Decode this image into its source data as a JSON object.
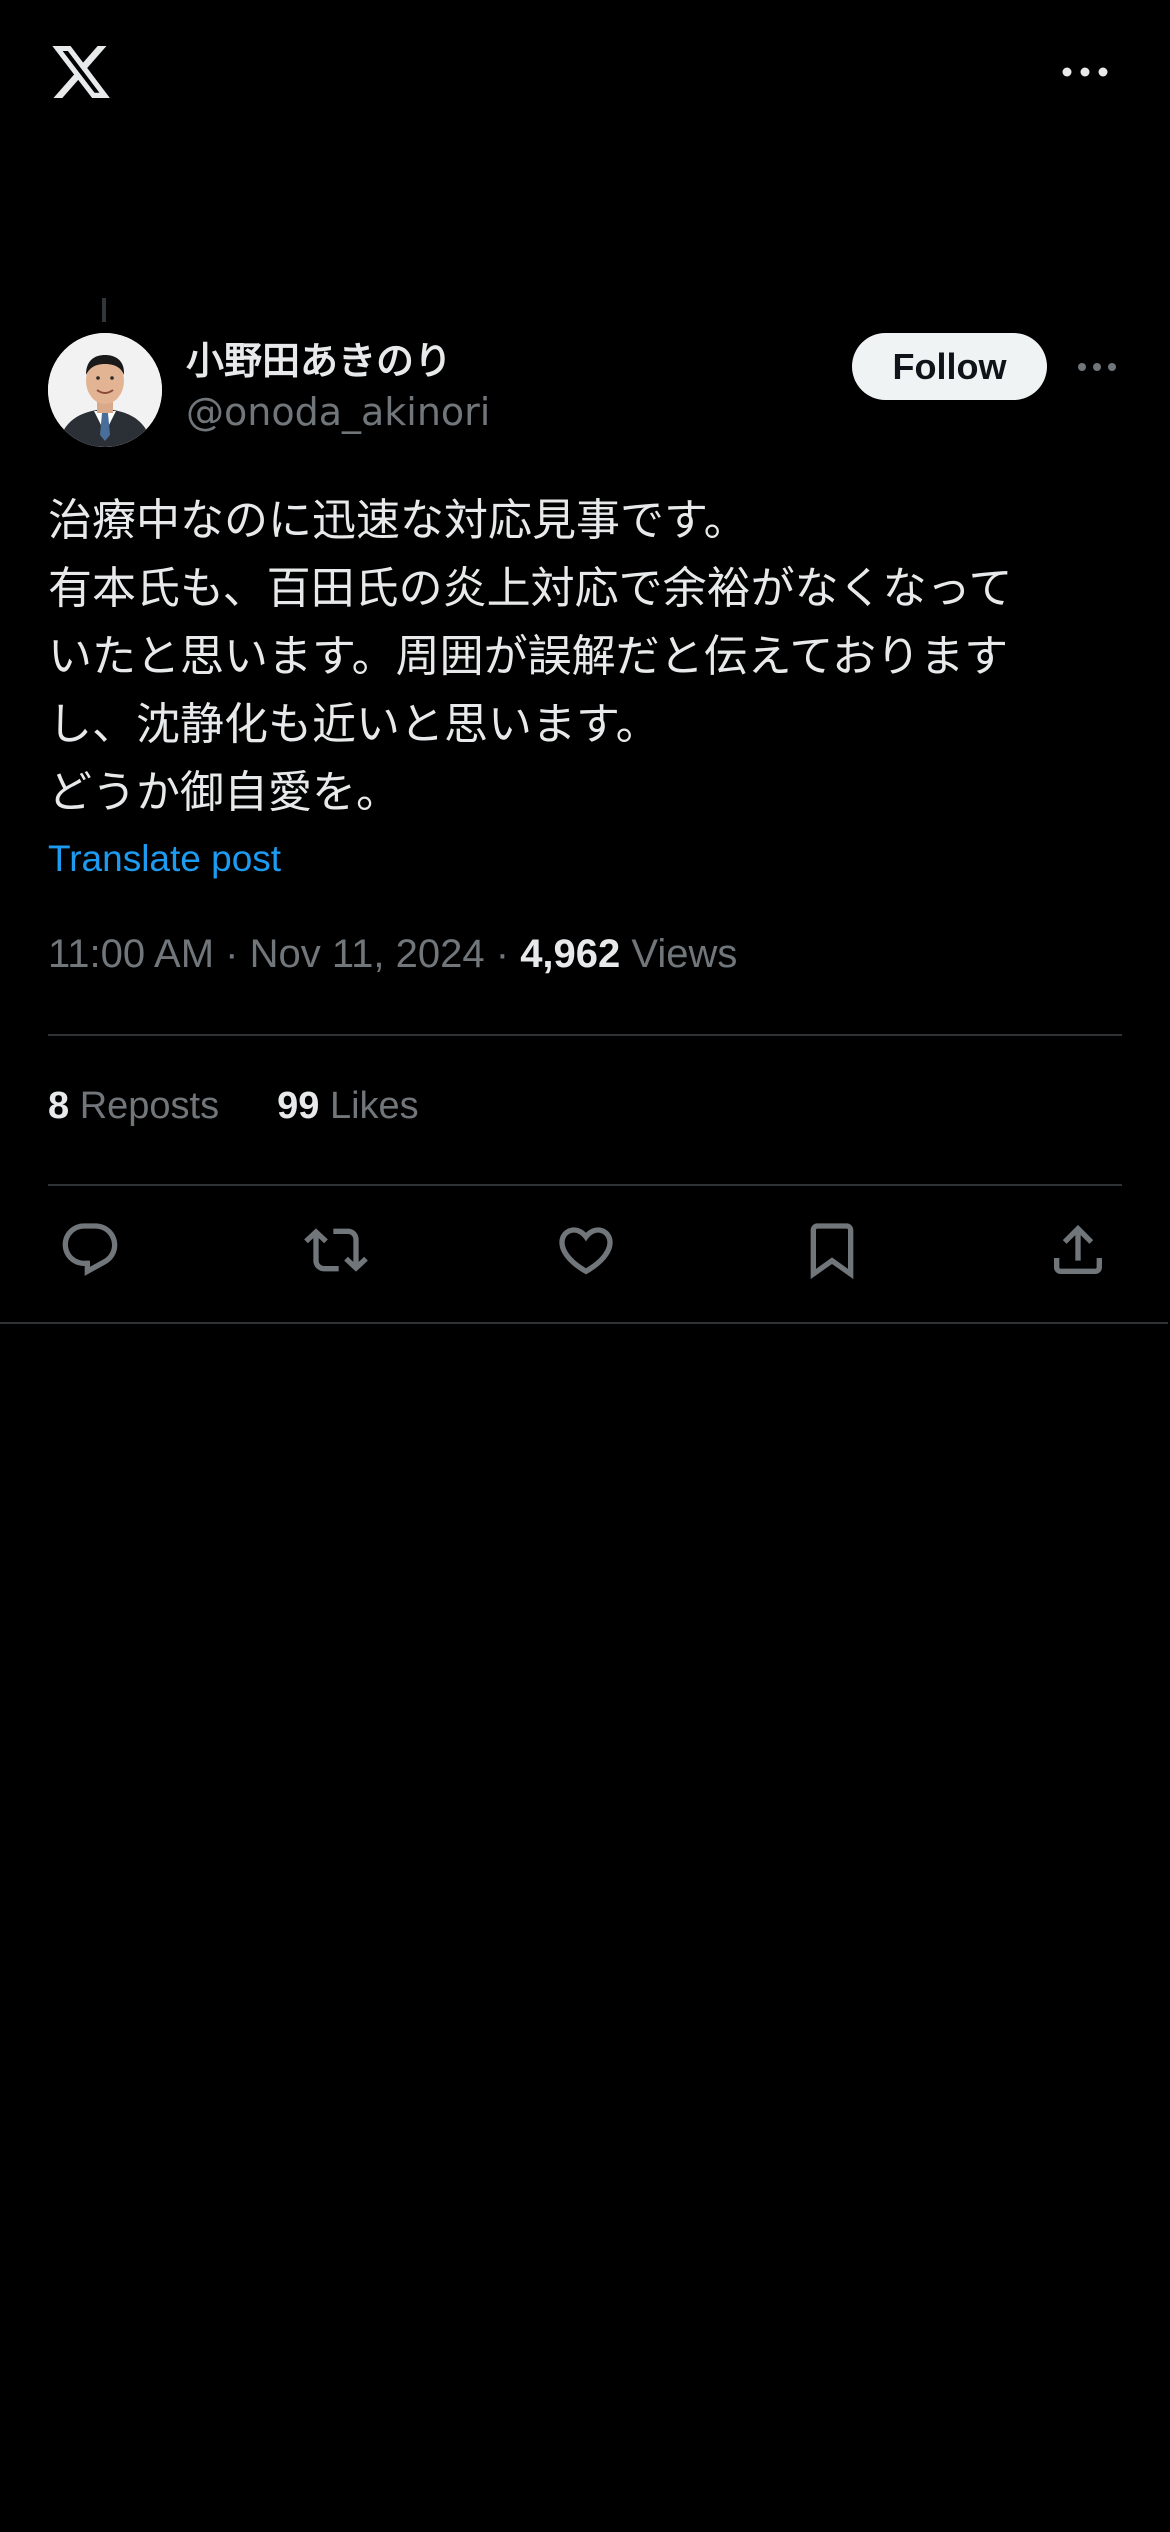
{
  "app": {
    "logo_icon": "x-logo-icon",
    "more_icon": "more-horizontal-icon"
  },
  "post": {
    "author": {
      "display_name": "小野田あきのり",
      "handle": "@onoda_akinori",
      "avatar_icon": "avatar-photo"
    },
    "follow_label": "Follow",
    "text_lines": [
      "治療中なのに迅速な対応見事です。",
      "有本氏も、百田氏の炎上対応で余裕がなくなって",
      "いたと思います。周囲が誤解だと伝えております",
      "し、沈静化も近いと思います。",
      "どうか御自愛を。"
    ],
    "translate_label": "Translate post",
    "time": "11:00 AM",
    "date": "Nov 11, 2024",
    "separator": "·",
    "views_count": "4,962",
    "views_label": "Views",
    "reposts_count": "8",
    "reposts_label": "Reposts",
    "likes_count": "99",
    "likes_label": "Likes"
  },
  "actions": {
    "reply_icon": "reply-icon",
    "repost_icon": "repost-icon",
    "like_icon": "heart-icon",
    "bookmark_icon": "bookmark-icon",
    "share_icon": "share-icon"
  },
  "colors": {
    "background": "#000000",
    "text_primary": "#e7e9ea",
    "text_secondary": "#71767b",
    "accent_link": "#1d9bf0",
    "divider": "#2f3336",
    "follow_bg": "#eff3f4"
  }
}
